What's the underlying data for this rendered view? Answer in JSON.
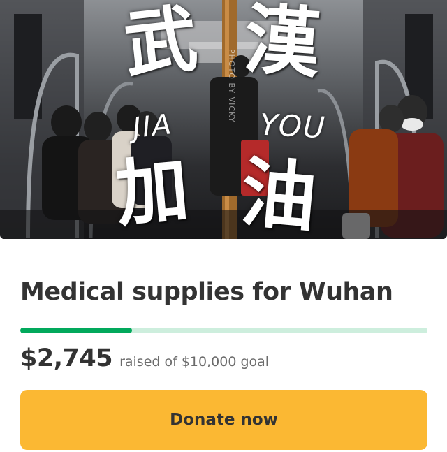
{
  "hero": {
    "overlay": {
      "top_left": "武",
      "top_right": "漢",
      "middle_left": "JIA",
      "middle_right": "YOU",
      "bottom_left": "加",
      "bottom_right": "油"
    },
    "photo_credit": "PHOTO BY VICKY"
  },
  "campaign": {
    "title": "Medical supplies for Wuhan",
    "raised_amount": "$2,745",
    "raised_text": "raised of $10,000 goal",
    "progress_fraction": 0.2745,
    "colors": {
      "progress_fill": "#02a95c",
      "progress_track": "#cdeedd",
      "donate_button": "#fbb833"
    }
  },
  "actions": {
    "donate_label": "Donate now"
  }
}
